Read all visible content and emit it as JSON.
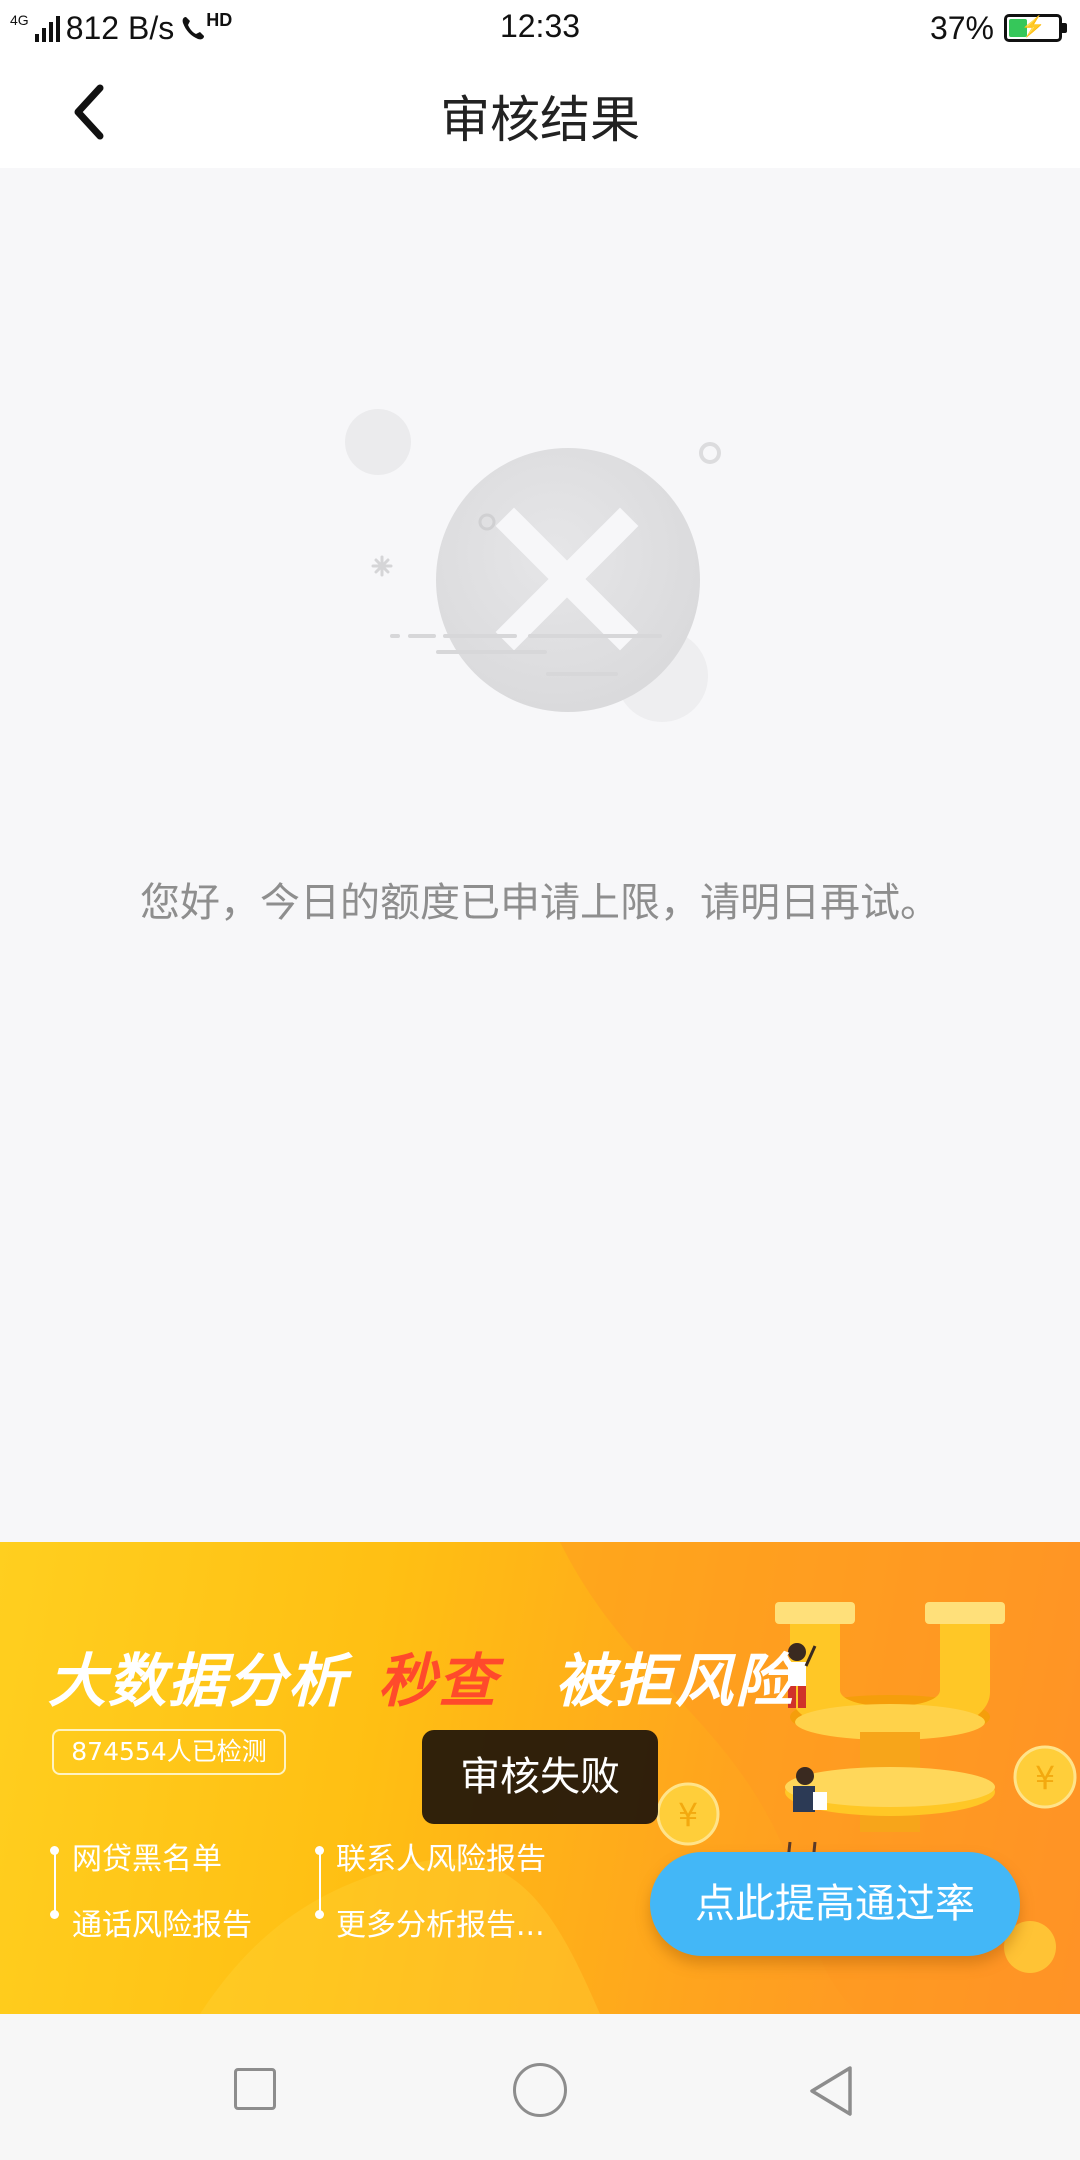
{
  "status_bar": {
    "network_type": "4G",
    "speed": "812 B/s",
    "hd_label": "HD",
    "time": "12:33",
    "battery_percent": "37%",
    "battery_level": 0.37
  },
  "header": {
    "title": "审核结果"
  },
  "main": {
    "message": "您好，今日的额度已申请上限，请明日再试。"
  },
  "banner": {
    "title_part1": "大数据分析",
    "title_part2": "秒查",
    "title_part3": "被拒风险",
    "count_text": "874554人已检测",
    "features": [
      "网贷黑名单",
      "通话风险报告",
      "联系人风险报告",
      "更多分析报告..."
    ],
    "cta_label": "点此提高通过率",
    "colors": {
      "accent_red": "#ff4a2b",
      "cta_blue": "#43b7f7",
      "background": "#ffbf13"
    }
  },
  "toast": {
    "text": "审核失败"
  }
}
